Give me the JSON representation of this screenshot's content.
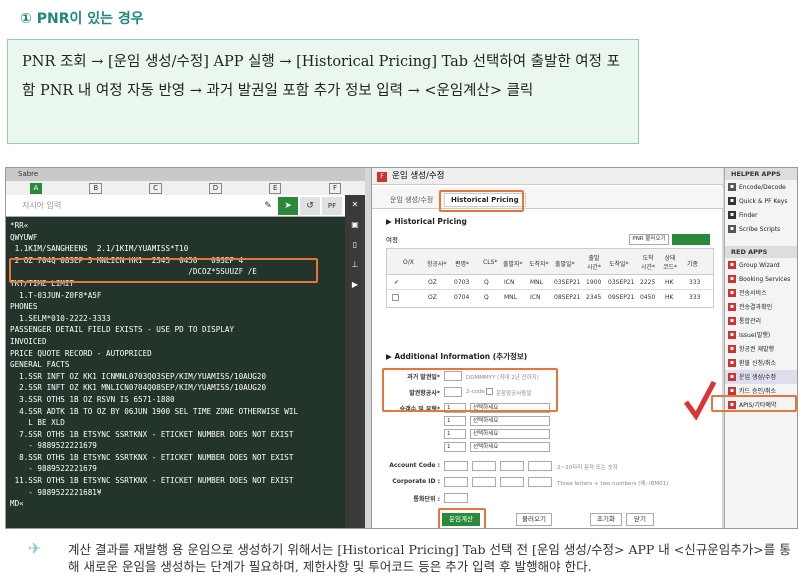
{
  "heading": "① PNR이 있는 경우",
  "info": "PNR 조회 → [운임 생성/수정] APP 실행 → [Historical Pricing] Tab 선택하여 출발한 여정 포함 PNR 내 여정 자동 반영 → 과거 발권일 포함 추가 정보 입력 → <운임계산> 클릭",
  "sabre": {
    "title": "Sabre",
    "tabs": [
      "A",
      "B",
      "C",
      "D",
      "E",
      "F"
    ],
    "input_placeholder": "지시어 입력",
    "btn_pf": "PF",
    "terminal": "*RR«\nQWYUWF\n 1.1KIM/SANGHEENS  2.1/1KIM/YUAMISS*T10\n 2 OZ 704Q 08SEP 3 MNLICN HK1  2345  0450   09SEP 4\n                                       /DCOZ*5SUUZF /E\nTKT/TIME LIMIT\n  1.T-03JUN-Z0F8*A5F\nPHONES\n  1.SELM*010-2222-3333\nPASSENGER DETAIL FIELD EXISTS - USE PD TO DISPLAY\nINVOICED\nPRICE QUOTE RECORD - AUTOPRICED\nGENERAL FACTS\n  1.SSR INFT OZ KK1 ICNMNL0703Q03SEP/KIM/YUAMISS/10AUG20\n  2.SSR INFT OZ KK1 MNLICN0704Q08SEP/KIM/YUAMISS/10AUG20\n  3.SSR OTHS 1B OZ RSVN IS 6571-1880\n  4.SSR ADTK 1B TO OZ BY 06JUN 1900 SEL TIME ZONE OTHERWISE WIL\n    L BE XLD\n  7.SSR OTHS 1B ETSYNC SSRTKNX - ETICKET NUMBER DOES NOT EXIST\n    - 9889522221679\n  8.SSR OTHS 1B ETSYNC SSRTKNX - ETICKET NUMBER DOES NOT EXIST\n    - 9889522221679\n 11.SSR OTHS 1B ETSYNC SSRTKNX - ETICKET NUMBER DOES NOT EXIST\n    - 9889522221681¥\nMD«"
  },
  "panel": {
    "title": "운임 생성/수정",
    "tab1": "운임 생성/수정",
    "tab2": "Historical Pricing",
    "section1": "▶ Historical Pricing",
    "itin_label": "여정",
    "pnr_btn": "PNR 불러오기",
    "columns": [
      "O/X",
      "항공사*",
      "편명*",
      "CLS*",
      "출발지*",
      "도착지*",
      "출발일*",
      "출발 시간*",
      "도착일*",
      "도착 시간*",
      "상태 코드*",
      "기종"
    ],
    "rows": [
      [
        "✔",
        "OZ",
        "0703",
        "Q",
        "ICN",
        "MNL",
        "03SEP21",
        "1900",
        "03SEP21",
        "2225",
        "HK",
        "333"
      ],
      [
        "",
        "OZ",
        "0704",
        "Q",
        "MNL",
        "ICN",
        "08SEP21",
        "2345",
        "09SEP21",
        "0450",
        "HK",
        "333"
      ]
    ],
    "section2": "▶ Additional Information (추가정보)",
    "issue_date_label": "과거 발권일*",
    "issue_date_hint": "DDMMMYY (최대 2년 전까지)",
    "airline_label": "발권항공사*",
    "airline_hint": "2-code",
    "airline_check": "운항항공사동일",
    "pax_label": "승객수 및 유형*",
    "pax_qty": "1",
    "pax_type": "선택하세요",
    "account_label": "Account Code :",
    "account_hint": "2~20자리 문자 또는 숫자",
    "corp_label": "Corporate ID :",
    "corp_hint": "Three letters + two numbers (예: IBM01)",
    "currency_label": "통화단위 :",
    "buttons": [
      "운임계산",
      "불러오기",
      "초기화",
      "닫기"
    ]
  },
  "helper": {
    "head1": "HELPER APPS",
    "apps1": [
      "Encode/Decode",
      "Quick & PF Keys",
      "Finder",
      "Scribe Scripts"
    ],
    "head2": "RED APPS",
    "apps2": [
      "Group Wizard",
      "Booking Services",
      "전송서비스",
      "전송결과확인",
      "통합관리",
      "Issue(발행)",
      "항공권 재발행",
      "환불 신청/취소",
      "운임 생성/수정",
      "카드 승인/취소",
      "APIS/기타예약"
    ]
  },
  "caption": "계산 결과를 재발행 용 운임으로 생성하기 위해서는 [Historical Pricing] Tab 선택 전 [운임 생성/수정> APP 내 <신규운임추가>를 통해 새로운 운임을 생성하는 단계가 필요하며, 제한사항 및 투어코드 등은 추가 입력 후 발행해야 한다.",
  "colors": {
    "accent": "#e8763a",
    "terminal_bg": "#23352b",
    "box_bg": "#eaf7ef",
    "heading": "#1f8a7a"
  }
}
